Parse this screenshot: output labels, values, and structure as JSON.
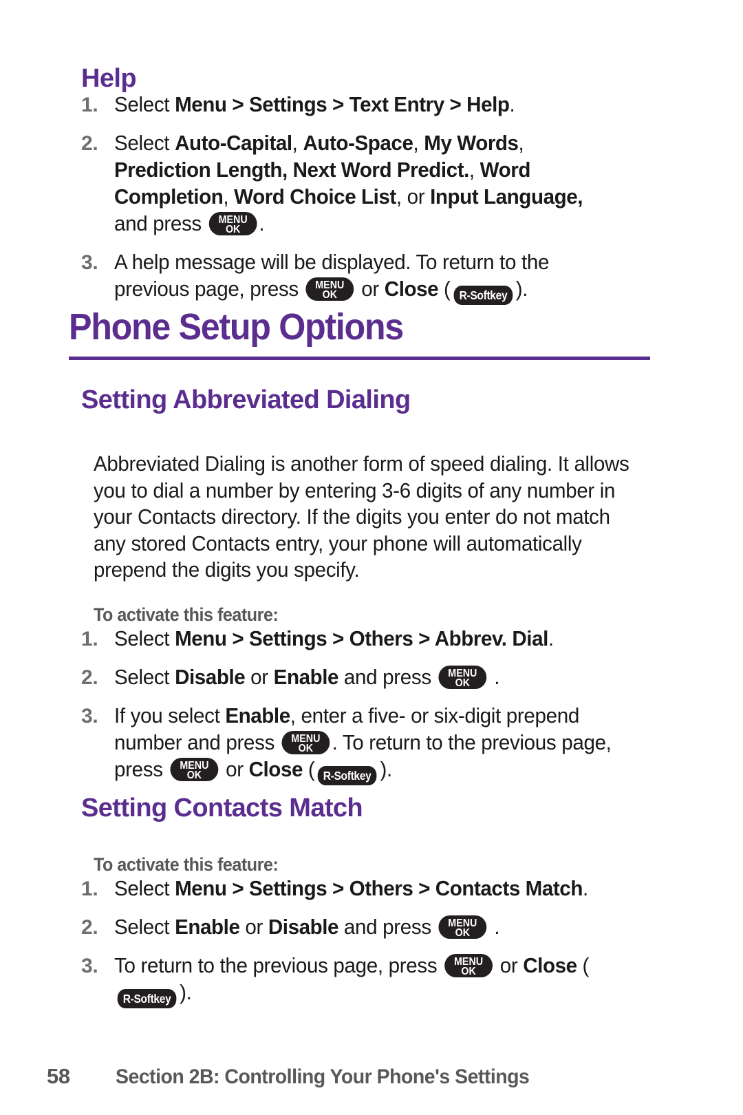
{
  "page": {
    "number": "58",
    "section": "Section 2B: Controlling Your Phone's Settings",
    "accent_color": "#5b2d8e",
    "body_color": "#1a1a1a",
    "muted_color": "#58585b"
  },
  "icons": {
    "menu_key": {
      "name": "menu-ok-key-icon",
      "line1": "MENU",
      "line2": "OK"
    },
    "softkey": {
      "name": "r-softkey-icon",
      "label": "R-Softkey"
    }
  },
  "help": {
    "heading": "Help",
    "steps": [
      {
        "number": "1.",
        "parts": [
          {
            "t": "text",
            "v": "Select "
          },
          {
            "t": "bold",
            "v": "Menu"
          },
          {
            "t": "bold",
            "v": " > "
          },
          {
            "t": "bold",
            "v": "Settings"
          },
          {
            "t": "bold",
            "v": " > "
          },
          {
            "t": "bold",
            "v": "Text Entry"
          },
          {
            "t": "bold",
            "v": " > "
          },
          {
            "t": "bold",
            "v": "Help"
          },
          {
            "t": "text",
            "v": "."
          }
        ]
      },
      {
        "number": "2.",
        "parts": [
          {
            "t": "text",
            "v": "Select "
          },
          {
            "t": "bold",
            "v": "Auto-Capital"
          },
          {
            "t": "text",
            "v": ", "
          },
          {
            "t": "bold",
            "v": "Auto-Space"
          },
          {
            "t": "text",
            "v": ", "
          },
          {
            "t": "bold",
            "v": "My Words"
          },
          {
            "t": "text",
            "v": ", "
          },
          {
            "t": "bold",
            "v": "Prediction Length, Next Word Predict."
          },
          {
            "t": "text",
            "v": ", "
          },
          {
            "t": "bold",
            "v": "Word Completion"
          },
          {
            "t": "text",
            "v": ", "
          },
          {
            "t": "bold",
            "v": "Word Choice List"
          },
          {
            "t": "text",
            "v": ", or "
          },
          {
            "t": "bold",
            "v": "Input Language,"
          },
          {
            "t": "text",
            "v": " and press "
          },
          {
            "t": "menukey"
          },
          {
            "t": "text",
            "v": "."
          }
        ]
      },
      {
        "number": "3.",
        "parts": [
          {
            "t": "text",
            "v": "A help message will be displayed. To return to the previous page, press "
          },
          {
            "t": "menukey"
          },
          {
            "t": "text",
            "v": " or "
          },
          {
            "t": "bold",
            "v": "Close"
          },
          {
            "t": "text",
            "v": " ("
          },
          {
            "t": "softkey"
          },
          {
            "t": "text",
            "v": ")."
          }
        ]
      }
    ]
  },
  "phone_setup": {
    "heading": "Phone Setup Options"
  },
  "abbreviated_dialing": {
    "heading": "Setting Abbreviated Dialing",
    "paragraph": "Abbreviated Dialing is another form of speed dialing. It allows you to dial a number by entering 3-6 digits of any number in your Contacts directory. If the digits you enter do not match any stored Contacts entry, your phone will automatically prepend the digits you specify.",
    "activate_label": "To activate this feature:",
    "steps": [
      {
        "number": "1.",
        "parts": [
          {
            "t": "text",
            "v": "Select "
          },
          {
            "t": "bold",
            "v": "Menu"
          },
          {
            "t": "bold",
            "v": " > "
          },
          {
            "t": "bold",
            "v": "Settings"
          },
          {
            "t": "bold",
            "v": " > "
          },
          {
            "t": "bold",
            "v": "Others"
          },
          {
            "t": "bold",
            "v": " > "
          },
          {
            "t": "bold",
            "v": "Abbrev. Dial"
          },
          {
            "t": "text",
            "v": "."
          }
        ]
      },
      {
        "number": "2.",
        "parts": [
          {
            "t": "text",
            "v": "Select "
          },
          {
            "t": "bold",
            "v": "Disable"
          },
          {
            "t": "text",
            "v": " or "
          },
          {
            "t": "bold",
            "v": "Enable"
          },
          {
            "t": "text",
            "v": " and press "
          },
          {
            "t": "menukey"
          },
          {
            "t": "text",
            "v": " ."
          }
        ]
      },
      {
        "number": "3.",
        "parts": [
          {
            "t": "text",
            "v": "If you select "
          },
          {
            "t": "bold",
            "v": "Enable"
          },
          {
            "t": "text",
            "v": ", enter a five- or six-digit prepend number and press "
          },
          {
            "t": "menukey"
          },
          {
            "t": "text",
            "v": ". To return to the previous page, press "
          },
          {
            "t": "menukey"
          },
          {
            "t": "text",
            "v": " or "
          },
          {
            "t": "bold",
            "v": "Close"
          },
          {
            "t": "text",
            "v": " ("
          },
          {
            "t": "softkey"
          },
          {
            "t": "text",
            "v": ")."
          }
        ]
      }
    ]
  },
  "contacts_match": {
    "heading": "Setting Contacts Match",
    "activate_label": "To activate this feature:",
    "steps": [
      {
        "number": "1.",
        "parts": [
          {
            "t": "text",
            "v": "Select "
          },
          {
            "t": "bold",
            "v": "Menu"
          },
          {
            "t": "bold",
            "v": " > "
          },
          {
            "t": "bold",
            "v": "Settings"
          },
          {
            "t": "bold",
            "v": " > "
          },
          {
            "t": "bold",
            "v": "Others"
          },
          {
            "t": "bold",
            "v": " > "
          },
          {
            "t": "bold",
            "v": "Contacts Match"
          },
          {
            "t": "text",
            "v": "."
          }
        ]
      },
      {
        "number": "2.",
        "parts": [
          {
            "t": "text",
            "v": "Select "
          },
          {
            "t": "bold",
            "v": "Enable"
          },
          {
            "t": "text",
            "v": " or "
          },
          {
            "t": "bold",
            "v": "Disable"
          },
          {
            "t": "text",
            "v": " and press "
          },
          {
            "t": "menukey"
          },
          {
            "t": "text",
            "v": " ."
          }
        ]
      },
      {
        "number": "3.",
        "parts": [
          {
            "t": "text",
            "v": "To return to the previous page, press "
          },
          {
            "t": "menukey"
          },
          {
            "t": "text",
            "v": " or "
          },
          {
            "t": "bold",
            "v": "Close"
          },
          {
            "t": "text",
            "v": " ("
          },
          {
            "t": "softkey"
          },
          {
            "t": "text",
            "v": ")."
          }
        ]
      }
    ]
  }
}
